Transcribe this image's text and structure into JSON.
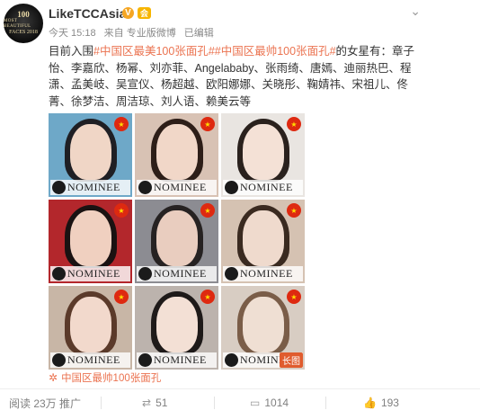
{
  "post": {
    "avatar": {
      "line1": "100",
      "line2": "MOST BEAUTIFUL",
      "line3": "FACES 2018"
    },
    "username": "LikeTCCAsia",
    "verified_mark": "V",
    "vip_mark": "会",
    "meta": {
      "time": "今天 15:18",
      "source": "来自 专业版微博",
      "edited": "已编辑"
    },
    "text": {
      "prefix": "目前入围",
      "tag1": "#中国区最美100张面孔#",
      "tag2": "#中国区最帅100张面孔#",
      "body": "的女星有：章子怡、李嘉欣、杨幂、刘亦菲、Angelababy、张雨绮、唐嫣、迪丽热巴、程潇、孟美岐、吴宣仪、杨超越、欧阳娜娜、关晓彤、鞠婧祎、宋祖儿、佟菁、徐梦洁、周洁琼、刘人语、赖美云等"
    },
    "images": [
      {
        "badge": "NOMINEE"
      },
      {
        "badge": "NOMINEE"
      },
      {
        "badge": "NOMINEE"
      },
      {
        "badge": "NOMINEE"
      },
      {
        "badge": "NOMINEE"
      },
      {
        "badge": "NOMINEE"
      },
      {
        "badge": "NOMINEE"
      },
      {
        "badge": "NOMINEE"
      },
      {
        "badge": "NOMINEE",
        "long_label": "长图"
      }
    ],
    "topic_link": "中国区最帅100张面孔"
  },
  "footer": {
    "reads": "阅读 23万",
    "promote": "推广",
    "reposts": "51",
    "comments": "1014",
    "likes": "193"
  },
  "colors": {
    "accent": "#eb7350",
    "flag": "#de2910",
    "vip": "#f7b500"
  }
}
